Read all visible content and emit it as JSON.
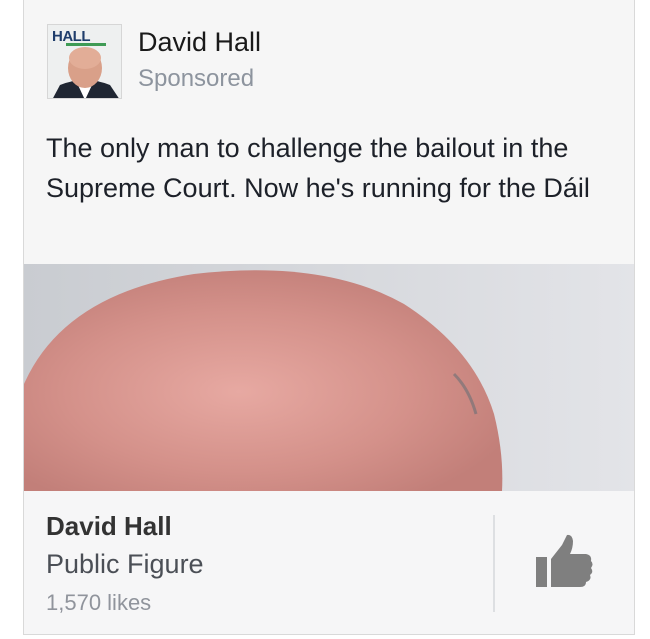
{
  "post": {
    "author": "David Hall",
    "sponsored_label": "Sponsored",
    "message": "The only man to challenge the bailout in the Supreme Court. Now he's running for the Dáil",
    "avatar_logo_text": "HALL"
  },
  "page": {
    "name": "David Hall",
    "category": "Public Figure",
    "likes": "1,570 likes"
  },
  "icons": {
    "like": "thumbs-up-icon"
  },
  "colors": {
    "card_background": "#f6f6f6",
    "secondary_text": "#8d949e",
    "like_icon": "#7f7f7f"
  }
}
